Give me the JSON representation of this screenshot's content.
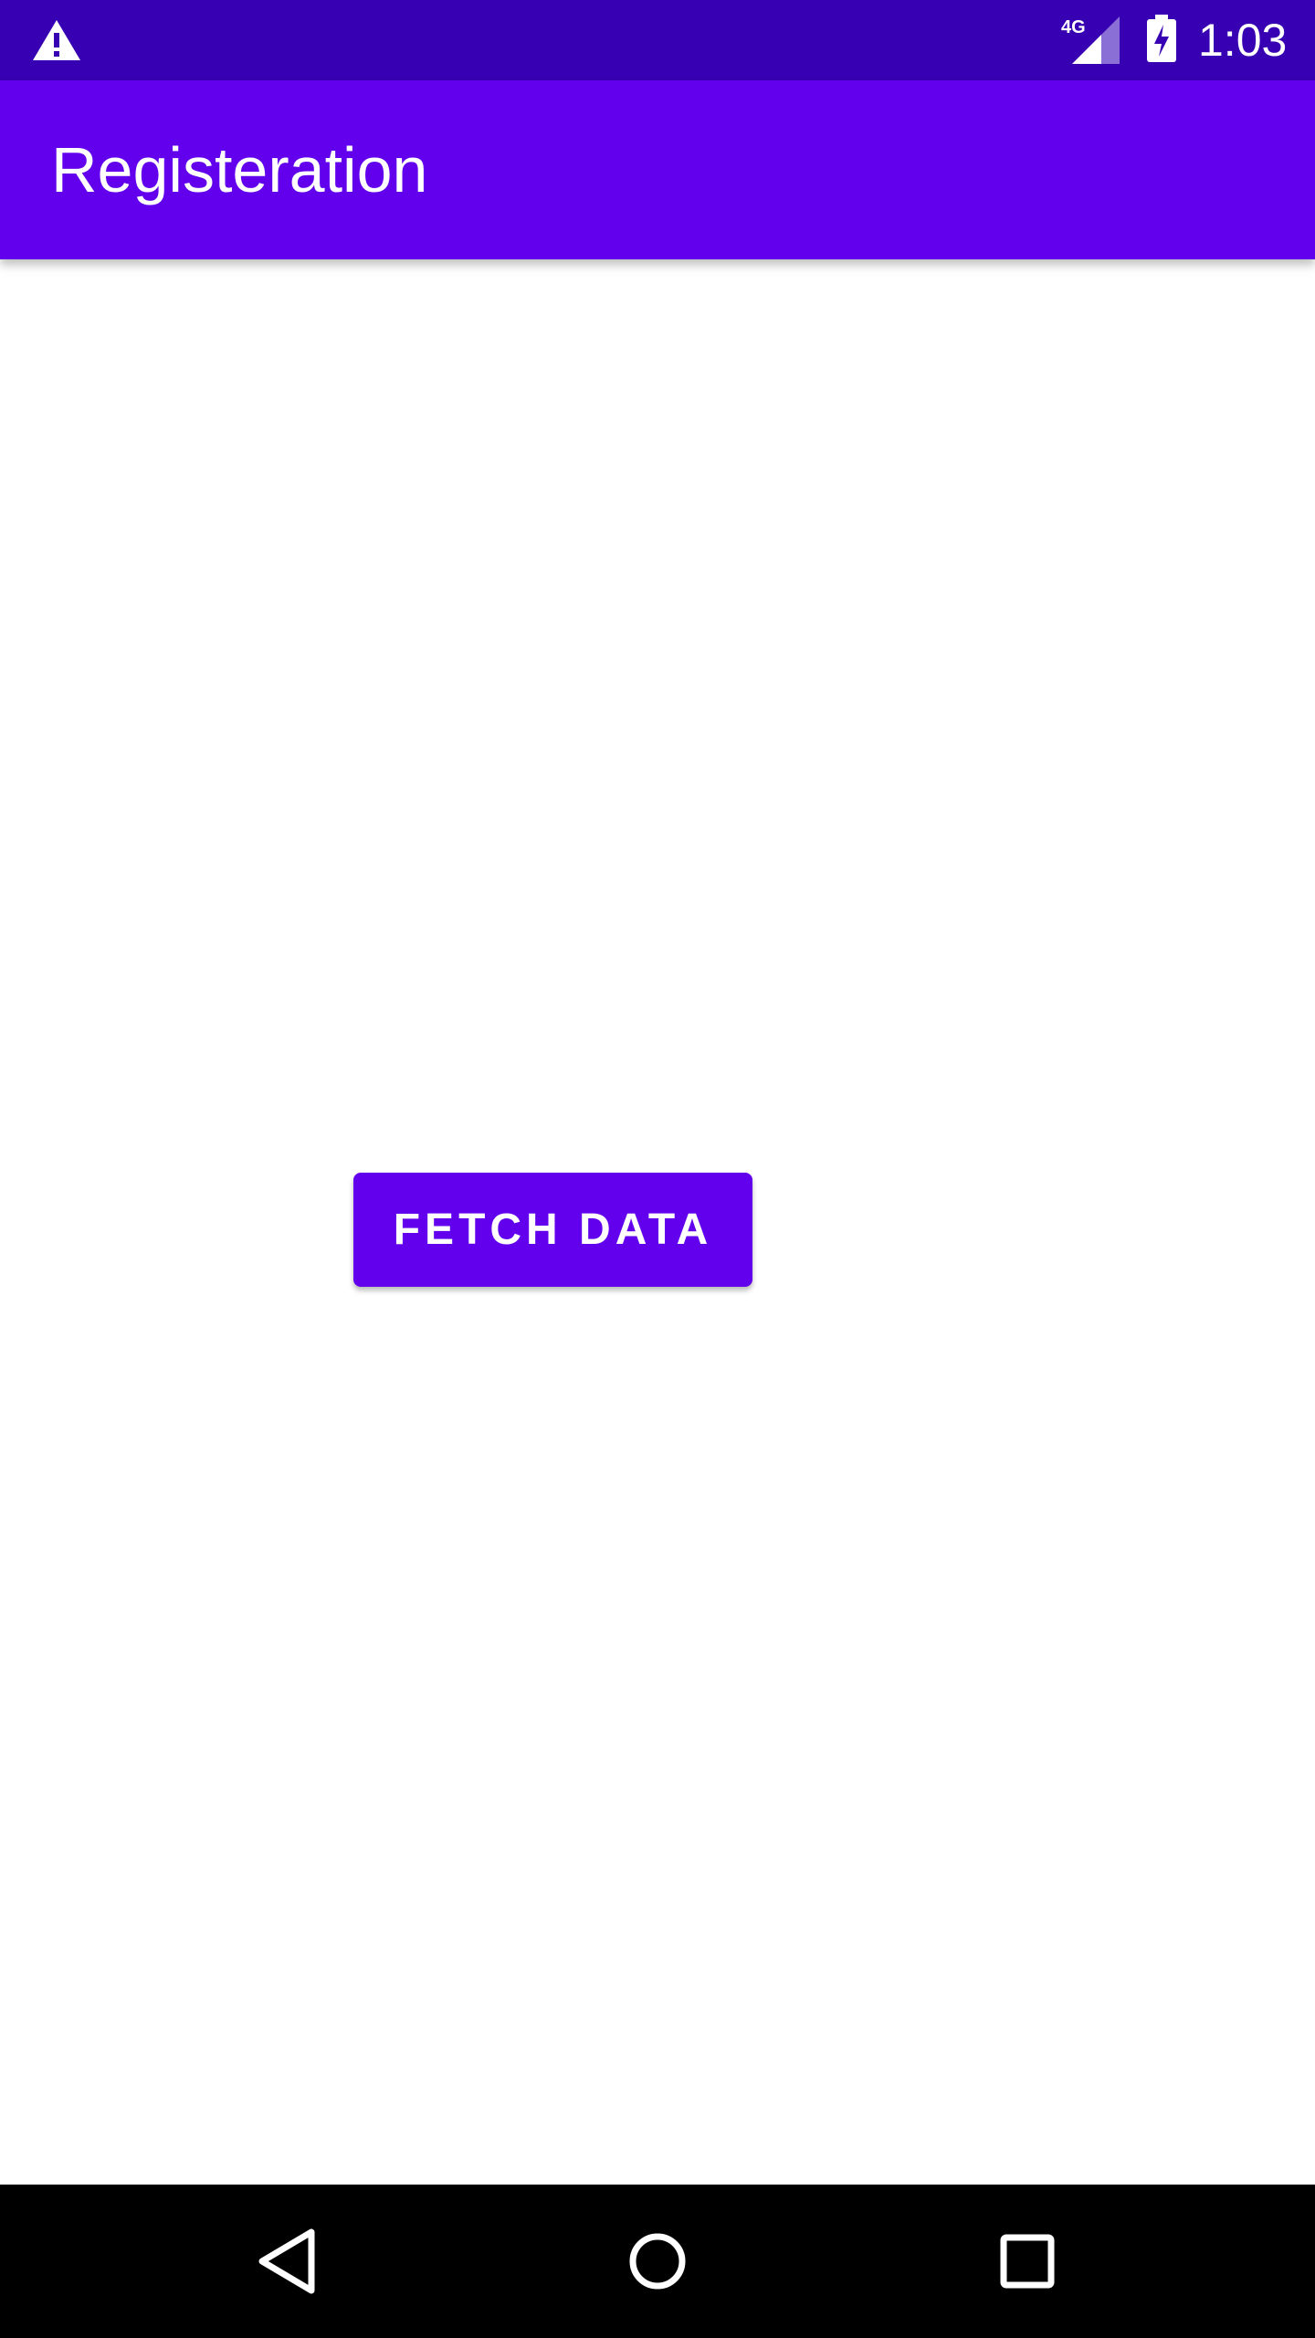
{
  "status_bar": {
    "time": "1:03",
    "network_label": "4G",
    "icons": [
      "warning-icon",
      "signal-icon",
      "battery-charging-icon"
    ],
    "background_color": "#3700b3"
  },
  "app_bar": {
    "title": "Registeration",
    "background_color": "#6200ee"
  },
  "main": {
    "fetch_button_label": "FETCH DATA",
    "button_color": "#6200ee"
  },
  "nav_bar": {
    "icons": [
      "back-icon",
      "home-icon",
      "recents-icon"
    ],
    "background_color": "#000000"
  }
}
